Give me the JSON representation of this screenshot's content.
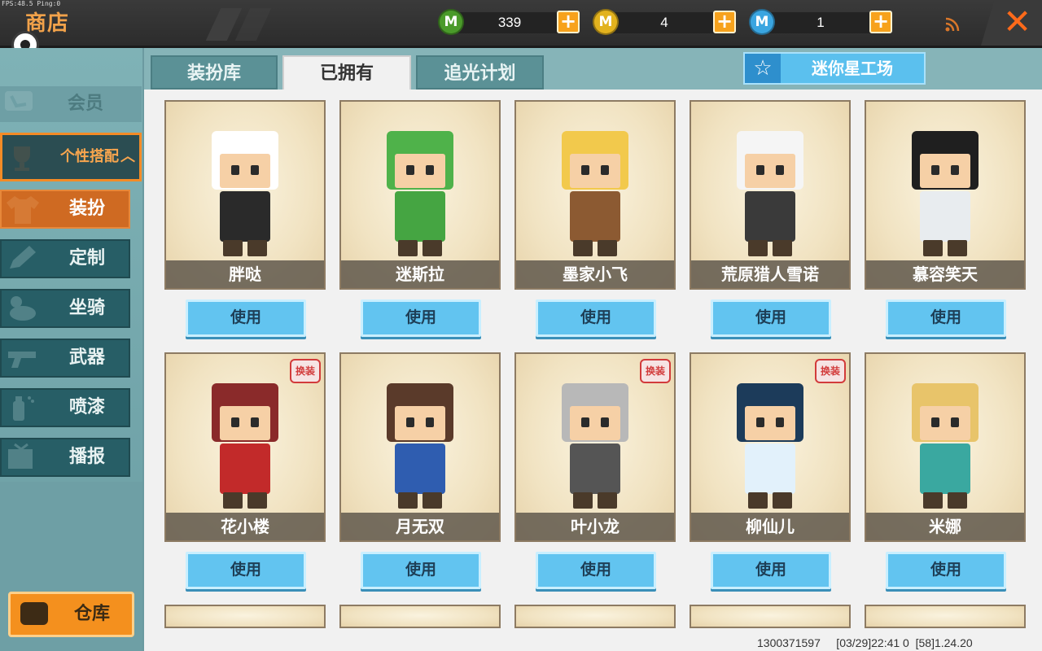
{
  "status_bar": {
    "fps_text": "FPS:48.5  Ping:0"
  },
  "header": {
    "title": "商店"
  },
  "currencies": [
    {
      "name": "green-gem",
      "value": "339",
      "icon_text": "M",
      "color": "#4a9a2a"
    },
    {
      "name": "gold-coin",
      "value": "4",
      "icon_text": "M",
      "color": "#e2b21e"
    },
    {
      "name": "blue-coin",
      "value": "1",
      "icon_text": "M",
      "color": "#3aa5e0"
    }
  ],
  "plus_label": "+",
  "close_label": "✕",
  "sidebar": {
    "member": "会员",
    "personal": "个性搭配",
    "personal_arrow": "^",
    "items": [
      {
        "label": "装扮",
        "icon": "shirt-icon"
      },
      {
        "label": "定制",
        "icon": "pencil-icon"
      },
      {
        "label": "坐骑",
        "icon": "mount-icon"
      },
      {
        "label": "武器",
        "icon": "gun-icon"
      },
      {
        "label": "喷漆",
        "icon": "spray-icon"
      },
      {
        "label": "播报",
        "icon": "broadcast-icon"
      }
    ],
    "warehouse": "仓库"
  },
  "tabs": {
    "wardrobe": "装扮库",
    "owned": "已拥有",
    "chase_light": "追光计划"
  },
  "workshop_button": "迷你星工场",
  "use_label": "使用",
  "badge_text": "换装",
  "cards": [
    {
      "name": "胖哒",
      "hair": "#ffffff",
      "outfit": "#2a2a2a",
      "badge": false
    },
    {
      "name": "迷斯拉",
      "hair": "#4fb24a",
      "outfit": "#45a542",
      "badge": false
    },
    {
      "name": "墨家小飞",
      "hair": "#f2c94c",
      "outfit": "#8c5a32",
      "badge": false
    },
    {
      "name": "荒原猎人雪诺",
      "hair": "#f5f5f5",
      "outfit": "#3a3a3a",
      "badge": false
    },
    {
      "name": "慕容笑天",
      "hair": "#1f1f1f",
      "outfit": "#e8ecef",
      "badge": false
    },
    {
      "name": "花小楼",
      "hair": "#8a2a2a",
      "outfit": "#c22a2a",
      "badge": true
    },
    {
      "name": "月无双",
      "hair": "#5a3a2a",
      "outfit": "#2f5db0",
      "badge": false
    },
    {
      "name": "叶小龙",
      "hair": "#b8b8b8",
      "outfit": "#555555",
      "badge": true
    },
    {
      "name": "柳仙儿",
      "hair": "#1c3b5a",
      "outfit": "#e2f1fb",
      "badge": true
    },
    {
      "name": "米娜",
      "hair": "#e8c46a",
      "outfit": "#3aa8a0",
      "badge": false
    }
  ],
  "footer": "1300371597     [03/29]22:41 0  [58]1.24.20"
}
